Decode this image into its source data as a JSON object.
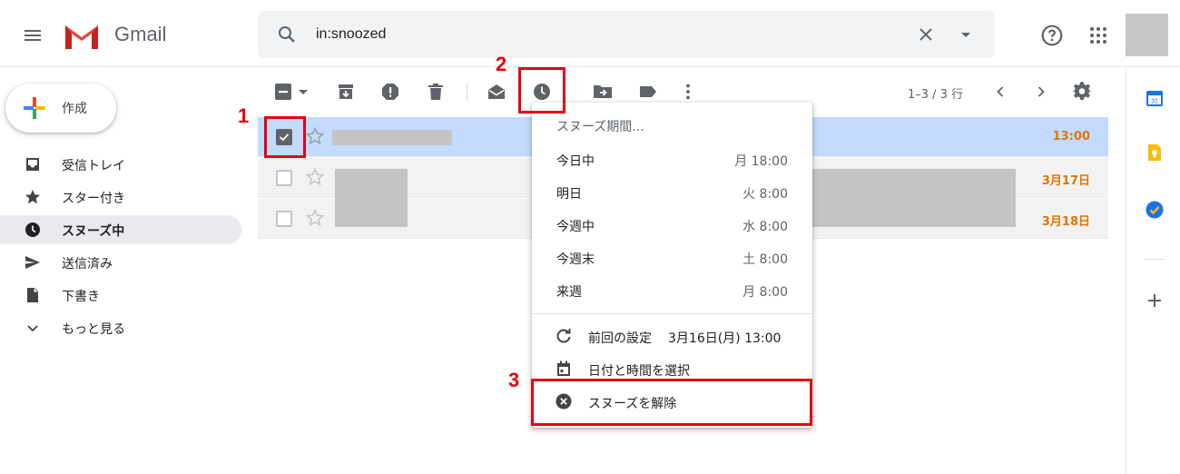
{
  "app": {
    "name": "Gmail"
  },
  "search": {
    "value": "in:snoozed"
  },
  "sidebar": {
    "compose_label": "作成",
    "items": [
      {
        "label": "受信トレイ"
      },
      {
        "label": "スター付き"
      },
      {
        "label": "スヌーズ中",
        "active": true
      },
      {
        "label": "送信済み"
      },
      {
        "label": "下書き"
      },
      {
        "label": "もっと見る"
      }
    ]
  },
  "toolbar": {
    "pagination": "1–3 / 3 行"
  },
  "mail_rows": [
    {
      "date": "13:00",
      "selected": true
    },
    {
      "date": "3月17日",
      "selected": false
    },
    {
      "date": "3月18日",
      "selected": false
    }
  ],
  "snooze_menu": {
    "title": "スヌーズ期間...",
    "options": [
      {
        "label": "今日中",
        "time": "月 18:00"
      },
      {
        "label": "明日",
        "time": "火 8:00"
      },
      {
        "label": "今週中",
        "time": "水 8:00"
      },
      {
        "label": "今週末",
        "time": "土 8:00"
      },
      {
        "label": "来週",
        "time": "月 8:00"
      }
    ],
    "last_setting_label": "前回の設定",
    "last_setting_value": "3月16日(月) 13:00",
    "pick_date_label": "日付と時間を選択",
    "unsnooze_label": "スヌーズを解除"
  },
  "annotations": {
    "step1": "1",
    "step2": "2",
    "step3": "3"
  },
  "colors": {
    "accent_red": "#e60012",
    "date_orange": "#e37400",
    "selected_row": "#c2dbff"
  },
  "icons": {
    "header": [
      "menu-icon",
      "gmail-logo",
      "search-icon",
      "close-icon",
      "arrow-drop-down-icon",
      "help-icon",
      "apps-icon"
    ],
    "toolbar": [
      "select-checkbox-icon",
      "archive-icon",
      "report-spam-icon",
      "delete-icon",
      "mark-read-icon",
      "snooze-clock-icon",
      "move-to-icon",
      "label-icon",
      "more-vert-icon",
      "chevron-left-icon",
      "chevron-right-icon",
      "settings-gear-icon"
    ],
    "side_panel": [
      "calendar-icon",
      "keep-icon",
      "tasks-icon",
      "add-icon"
    ]
  }
}
